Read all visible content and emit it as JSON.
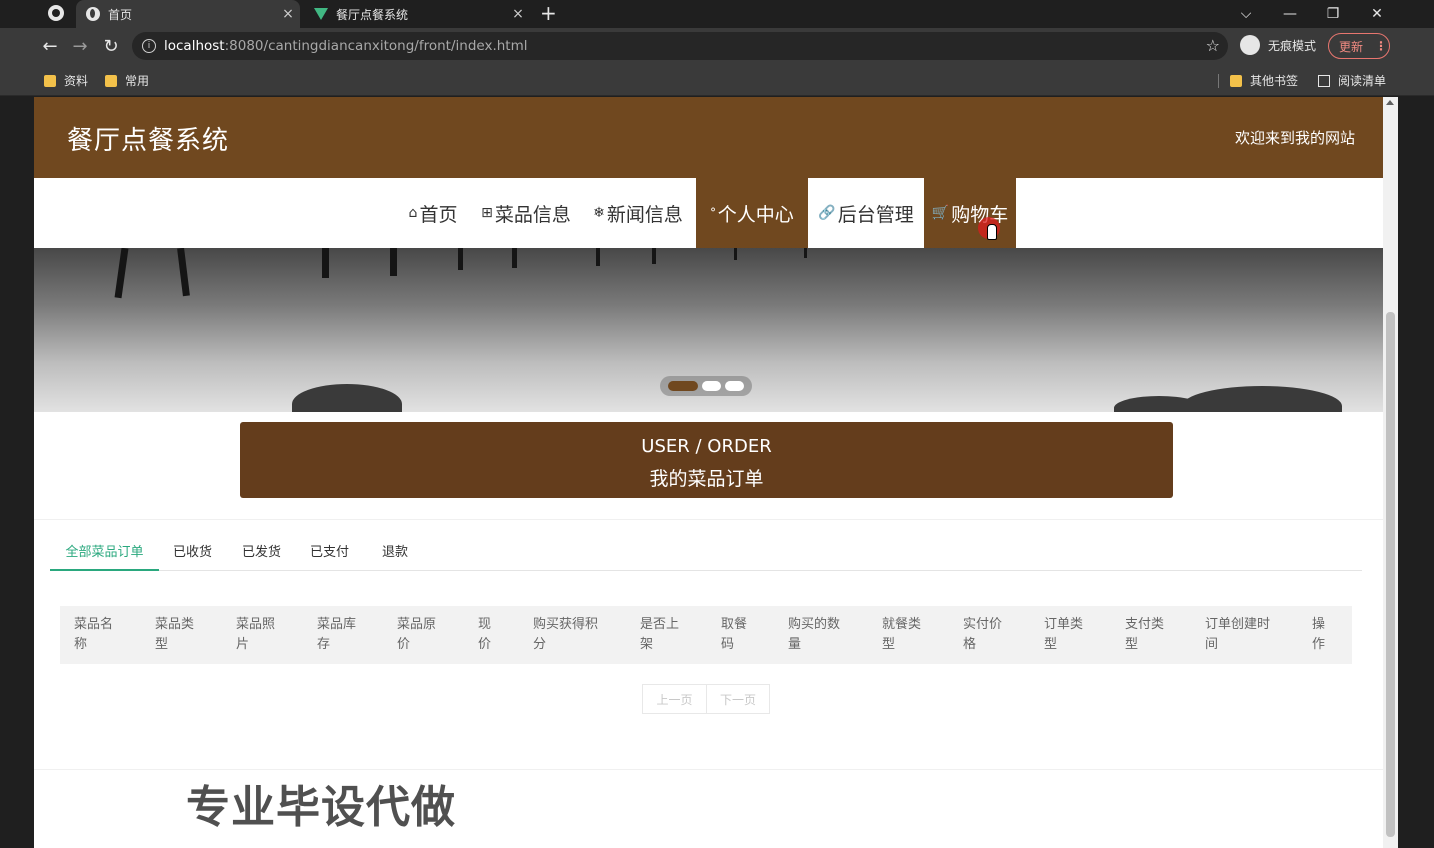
{
  "browser": {
    "tabs": [
      {
        "title": "首页",
        "icon": "globe-icon",
        "active": true
      },
      {
        "title": "餐厅点餐系统",
        "icon": "vue-icon",
        "active": false
      }
    ],
    "close_symbol": "×",
    "new_tab_symbol": "+",
    "window_controls": {
      "tab_search": "⌵",
      "minimize": "—",
      "restore": "❐",
      "close": "✕"
    },
    "nav": {
      "back": "←",
      "forward": "→",
      "reload": "↻"
    },
    "url": {
      "host": "localhost",
      "rest": ":8080/cantingdiancanxitong/front/index.html"
    },
    "star_symbol": "☆",
    "incognito_label": "无痕模式",
    "update_label": "更新",
    "update_menu": "⋮",
    "bookmarks_left": [
      "资料",
      "常用"
    ],
    "bookmarks_right": [
      "其他书签",
      "阅读清单"
    ]
  },
  "site": {
    "title": "餐厅点餐系统",
    "welcome": "欢迎来到我的网站",
    "nav": [
      {
        "icon": "⌂",
        "label": "首页",
        "active": false
      },
      {
        "icon": "⊞",
        "label": "菜品信息",
        "active": false
      },
      {
        "icon": "❄",
        "label": "新闻信息",
        "active": false
      },
      {
        "icon": "ᐤ",
        "label": "个人中心",
        "active": true
      },
      {
        "icon": "🔗",
        "label": "后台管理",
        "active": false
      },
      {
        "icon": "🛒",
        "label": "购物车",
        "active": true
      }
    ]
  },
  "order_header": {
    "en": "USER / ORDER",
    "cn": "我的菜品订单"
  },
  "order_tabs": [
    {
      "label": "全部菜品订单",
      "active": true
    },
    {
      "label": "已收货",
      "active": false
    },
    {
      "label": "已发货",
      "active": false
    },
    {
      "label": "已支付",
      "active": false
    },
    {
      "label": "退款",
      "active": false
    }
  ],
  "table_columns": [
    [
      "菜品名",
      "称"
    ],
    [
      "菜品类",
      "型"
    ],
    [
      "菜品照",
      "片"
    ],
    [
      "菜品库",
      "存"
    ],
    [
      "菜品原",
      "价"
    ],
    [
      "现",
      "价"
    ],
    [
      "购买获得积",
      "分"
    ],
    [
      "是否上",
      "架"
    ],
    [
      "取餐",
      "码"
    ],
    [
      "购买的数",
      "量"
    ],
    [
      "就餐类",
      "型"
    ],
    [
      "实付价",
      "格"
    ],
    [
      "订单类",
      "型"
    ],
    [
      "支付类",
      "型"
    ],
    [
      "订单创建时",
      "间"
    ],
    [
      "操",
      "作"
    ]
  ],
  "pagination": {
    "prev": "上一页",
    "next": "下一页"
  },
  "watermark": "专业毕设代做",
  "colors": {
    "brand": "#70481f",
    "order_box": "#643d1c",
    "tab_accent": "#2aa87e"
  }
}
